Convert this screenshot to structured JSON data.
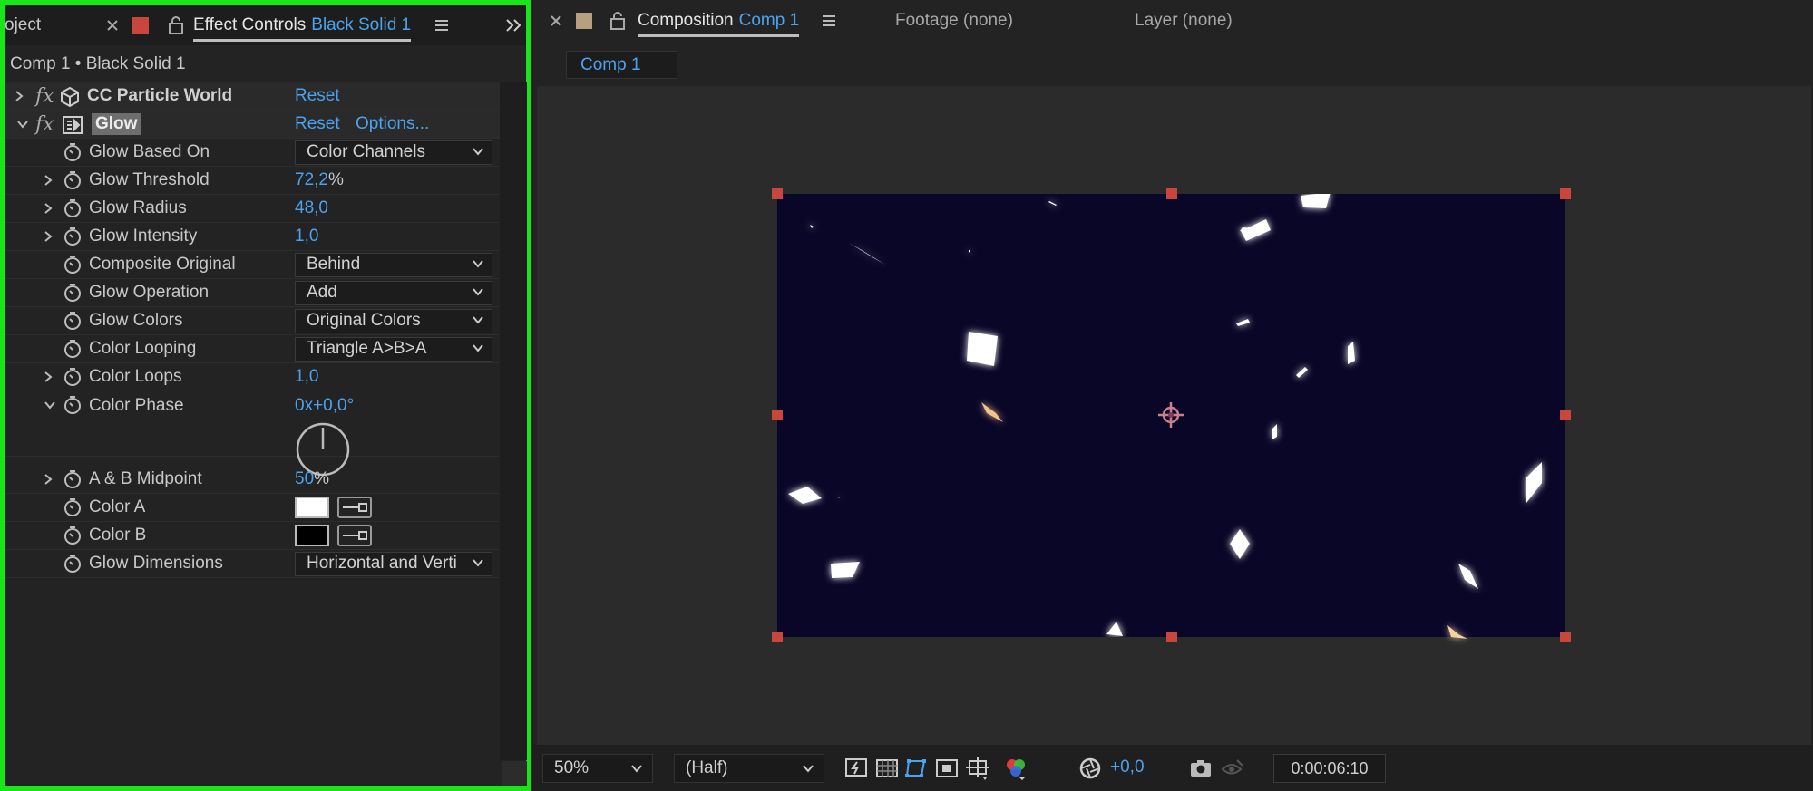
{
  "left_panel": {
    "tabs": {
      "project_partial": "oject",
      "effect_controls_label": "Effect Controls",
      "effect_controls_layer": "Black Solid 1"
    },
    "subtitle": "Comp 1 • Black Solid 1",
    "cc_particle": {
      "name": "CC Particle World",
      "reset": "Reset"
    },
    "glow": {
      "name": "Glow",
      "reset": "Reset",
      "options": "Options...",
      "params": [
        {
          "label": "Glow Based On",
          "kind": "dropdown",
          "value": "Color Channels"
        },
        {
          "label": "Glow Threshold",
          "kind": "number",
          "value": "72,2",
          "unit": "%",
          "expandable": true
        },
        {
          "label": "Glow Radius",
          "kind": "number",
          "value": "48,0",
          "unit": "",
          "expandable": true
        },
        {
          "label": "Glow Intensity",
          "kind": "number",
          "value": "1,0",
          "unit": "",
          "expandable": true
        },
        {
          "label": "Composite Original",
          "kind": "dropdown",
          "value": "Behind"
        },
        {
          "label": "Glow Operation",
          "kind": "dropdown",
          "value": "Add"
        },
        {
          "label": "Glow Colors",
          "kind": "dropdown",
          "value": "Original Colors"
        },
        {
          "label": "Color Looping",
          "kind": "dropdown",
          "value": "Triangle A>B>A"
        },
        {
          "label": "Color Loops",
          "kind": "number",
          "value": "1,0",
          "unit": "",
          "expandable": true
        },
        {
          "label": "Color Phase",
          "kind": "angle",
          "value": "0x+0,0°",
          "expanded": true
        },
        {
          "label": "A & B Midpoint",
          "kind": "number",
          "value": "50",
          "unit": "%",
          "expandable": true
        },
        {
          "label": "Color A",
          "kind": "color",
          "color": "#ffffff"
        },
        {
          "label": "Color B",
          "kind": "color",
          "color": "#000000"
        },
        {
          "label": "Glow Dimensions",
          "kind": "dropdown",
          "value": "Horizontal and Verti"
        }
      ]
    }
  },
  "right_panel": {
    "tabs": {
      "composition_label": "Composition",
      "composition_name": "Comp 1",
      "footage": "Footage (none)",
      "layer": "Layer (none)"
    },
    "comp_chip": "Comp 1",
    "canvas": {
      "background": "#0a0628",
      "handle_color": "#c9463d"
    },
    "bottom_bar": {
      "zoom": "50%",
      "resolution": "(Half)",
      "exposure": "+0,0",
      "timecode": "0:00:06:10"
    }
  },
  "colors": {
    "accent": "#4aa3f0",
    "highlight_border": "#18e618",
    "label_red": "#c9463d",
    "label_tan": "#b7a07f"
  }
}
